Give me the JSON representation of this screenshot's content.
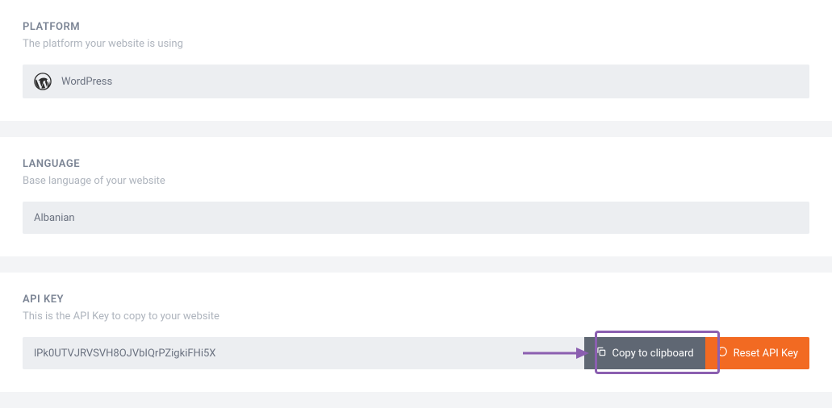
{
  "platform": {
    "title": "PLATFORM",
    "subtitle": "The platform your website is using",
    "value": "WordPress",
    "icon": "wordpress-icon"
  },
  "language": {
    "title": "LANGUAGE",
    "subtitle": "Base language of your website",
    "value": "Albanian"
  },
  "apiKey": {
    "title": "API KEY",
    "subtitle": "This is the API Key to copy to your website",
    "value": "lPk0UTVJRVSVH8OJVbIQrPZigkiFHi5X",
    "copyLabel": "Copy to clipboard",
    "resetLabel": "Reset API Key"
  },
  "colors": {
    "accent": "#f26a22",
    "darkBtn": "#5f6773",
    "annotation": "#8b5fb0"
  }
}
